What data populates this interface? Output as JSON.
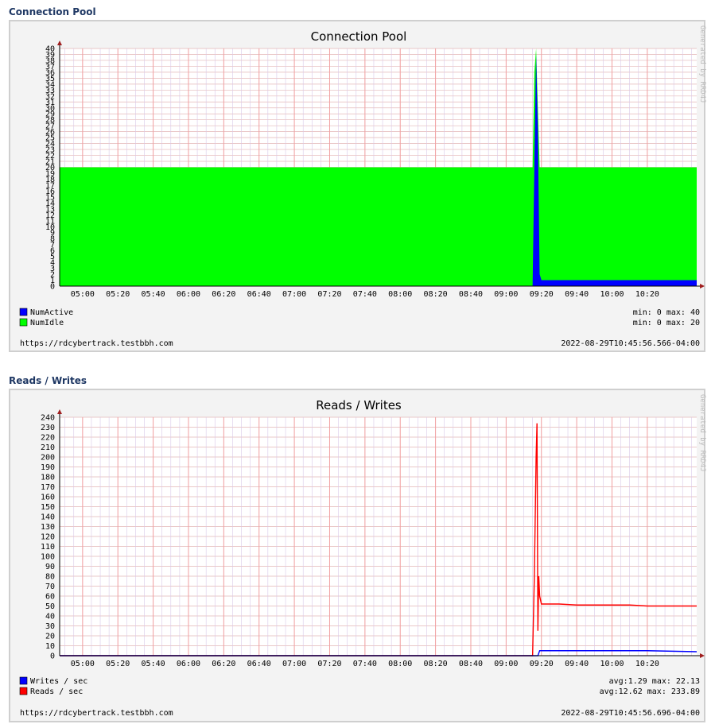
{
  "sections": [
    {
      "title": "Connection Pool"
    },
    {
      "title": "Reads / Writes"
    }
  ],
  "watermark": "Generated by RRD4J",
  "colors": {
    "active": "#0000ff",
    "idle": "#00ff00",
    "reads": "#ff0000",
    "writes": "#0000ff",
    "grid_major": "#f2a0a0",
    "grid_minor": "#e3b6b6"
  },
  "chart_data": [
    {
      "type": "area",
      "title": "Connection Pool",
      "x_ticks": [
        "05:00",
        "05:20",
        "05:40",
        "06:00",
        "06:20",
        "06:40",
        "07:00",
        "07:20",
        "07:40",
        "08:00",
        "08:20",
        "08:40",
        "09:00",
        "09:20",
        "09:40",
        "10:00",
        "10:20"
      ],
      "x_range": [
        "04:47",
        "10:48"
      ],
      "ylim": [
        0,
        40
      ],
      "y_ticks": [
        0,
        1,
        2,
        3,
        4,
        5,
        6,
        7,
        8,
        9,
        10,
        11,
        12,
        13,
        14,
        15,
        16,
        17,
        18,
        19,
        20,
        21,
        22,
        23,
        24,
        25,
        26,
        27,
        28,
        29,
        30,
        31,
        32,
        33,
        34,
        35,
        36,
        37,
        38,
        39,
        40
      ],
      "stacked": true,
      "grid": true,
      "series": [
        {
          "name": "NumActive",
          "color": "#0000ff",
          "points": [
            [
              "04:47",
              0
            ],
            [
              "09:15",
              0
            ],
            [
              "09:16",
              20
            ],
            [
              "09:17",
              39
            ],
            [
              "09:18",
              26
            ],
            [
              "09:19",
              2
            ],
            [
              "09:20",
              1
            ],
            [
              "09:40",
              1
            ],
            [
              "10:00",
              1
            ],
            [
              "10:20",
              1
            ],
            [
              "10:48",
              1
            ]
          ]
        },
        {
          "name": "NumIdle",
          "color": "#00ff00",
          "points": [
            [
              "04:47",
              20
            ],
            [
              "09:15",
              20
            ],
            [
              "09:16",
              16
            ],
            [
              "09:17",
              1
            ],
            [
              "09:18",
              4
            ],
            [
              "09:19",
              18
            ],
            [
              "09:20",
              19
            ],
            [
              "09:40",
              19
            ],
            [
              "10:00",
              19
            ],
            [
              "10:20",
              19
            ],
            [
              "10:48",
              19
            ]
          ]
        }
      ],
      "legend": [
        {
          "name": "NumActive",
          "stats": "min:  0  max: 40"
        },
        {
          "name": "NumIdle",
          "stats": "min:  0  max: 20"
        }
      ],
      "footer_left": "https://rdcybertrack.testbbh.com",
      "footer_right": "2022-08-29T10:45:56.566-04:00"
    },
    {
      "type": "line",
      "title": "Reads / Writes",
      "x_ticks": [
        "05:00",
        "05:20",
        "05:40",
        "06:00",
        "06:20",
        "06:40",
        "07:00",
        "07:20",
        "07:40",
        "08:00",
        "08:20",
        "08:40",
        "09:00",
        "09:20",
        "09:40",
        "10:00",
        "10:20"
      ],
      "x_range": [
        "04:47",
        "10:48"
      ],
      "ylim": [
        0,
        240
      ],
      "y_ticks": [
        0,
        10,
        20,
        30,
        40,
        50,
        60,
        70,
        80,
        90,
        100,
        110,
        120,
        130,
        140,
        150,
        160,
        170,
        180,
        190,
        200,
        210,
        220,
        230,
        240
      ],
      "grid": true,
      "series": [
        {
          "name": "Reads / sec",
          "color": "#ff0000",
          "points": [
            [
              "04:47",
              0
            ],
            [
              "09:15",
              0
            ],
            [
              "09:16",
              80
            ],
            [
              "09:17",
              200
            ],
            [
              "09:17.5",
              233.89
            ],
            [
              "09:18",
              25
            ],
            [
              "09:18.5",
              80
            ],
            [
              "09:19",
              60
            ],
            [
              "09:20",
              52
            ],
            [
              "09:30",
              52
            ],
            [
              "09:40",
              51
            ],
            [
              "09:50",
              51
            ],
            [
              "10:00",
              51
            ],
            [
              "10:10",
              51
            ],
            [
              "10:20",
              50
            ],
            [
              "10:30",
              50
            ],
            [
              "10:48",
              50
            ]
          ]
        },
        {
          "name": "Writes / sec",
          "color": "#0000ff",
          "points": [
            [
              "04:47",
              0
            ],
            [
              "09:18",
              0
            ],
            [
              "09:19",
              5
            ],
            [
              "09:30",
              5
            ],
            [
              "09:40",
              5
            ],
            [
              "10:00",
              5
            ],
            [
              "10:20",
              5
            ],
            [
              "10:48",
              4
            ]
          ]
        }
      ],
      "legend": [
        {
          "name": "Writes / sec",
          "stats": "avg:1.29  max: 22.13"
        },
        {
          "name": "Reads / sec",
          "stats": "avg:12.62  max: 233.89"
        }
      ],
      "footer_left": "https://rdcybertrack.testbbh.com",
      "footer_right": "2022-08-29T10:45:56.696-04:00"
    }
  ]
}
